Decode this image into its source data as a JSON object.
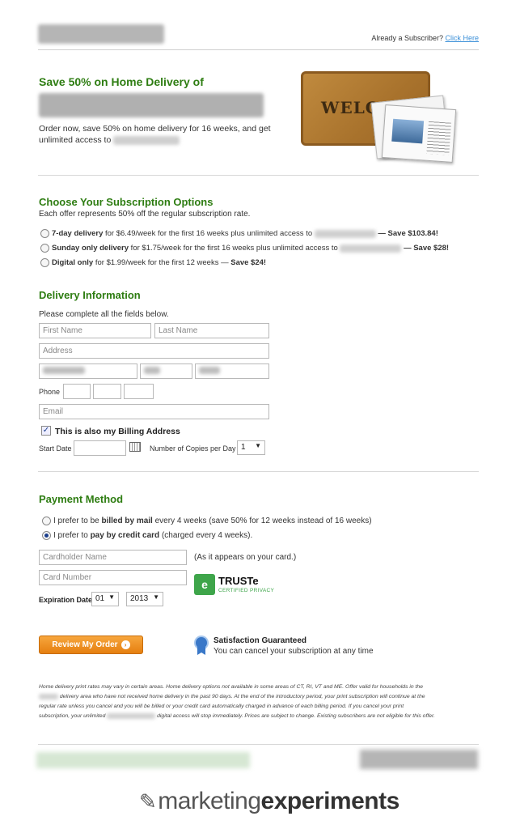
{
  "header": {
    "subscriber_text": "Already a Subscriber?",
    "click_here": "Click Here"
  },
  "hero": {
    "title": "Save 50% on Home Delivery of",
    "text": "Order now, save 50% on home delivery for 16 weeks, and get unlimited access to",
    "doormat_word": "WELCO"
  },
  "subscription": {
    "title": "Choose Your Subscription Options",
    "subtitle": "Each offer represents 50% off the regular subscription rate.",
    "options": [
      {
        "bold": "7-day delivery",
        "text": " for $6.49/week for the first 16 weeks plus unlimited access to",
        "save": "— Save $103.84!"
      },
      {
        "bold": "Sunday only delivery",
        "text": " for $1.75/week for the first 16 weeks plus unlimited access to",
        "save": "— Save $28!"
      },
      {
        "bold": "Digital only",
        "text": " for $1.99/week for the first 12 weeks —",
        "save": "Save $24!"
      }
    ]
  },
  "delivery": {
    "title": "Delivery Information",
    "instructions": "Please complete all the fields below.",
    "first_name_placeholder": "First Name",
    "last_name_placeholder": "Last Name",
    "address_placeholder": "Address",
    "phone_label": "Phone",
    "email_placeholder": "Email",
    "billing_label": "This is also my Billing Address",
    "start_date_label": "Start Date",
    "copies_label": "Number of Copies per Day",
    "copies_value": "1"
  },
  "payment": {
    "title": "Payment Method",
    "mail_option_prefix": "I prefer to be ",
    "mail_option_bold": "billed by mail",
    "mail_option_suffix": " every 4 weeks (save 50% for 12 weeks instead of 16 weeks)",
    "card_option_prefix": "I prefer to ",
    "card_option_bold": "pay by credit card",
    "card_option_suffix": " (charged every 4 weeks).",
    "cardholder_placeholder": "Cardholder Name",
    "cardholder_hint": "(As it appears on your card.)",
    "card_number_placeholder": "Card Number",
    "expiration_label": "Expiration Date",
    "exp_month": "01",
    "exp_year": "2013",
    "truste_name": "TRUSTe",
    "truste_cert": "CERTIFIED PRIVACY"
  },
  "actions": {
    "review_button": "Review My Order",
    "satisfaction_title": "Satisfaction Guaranteed",
    "satisfaction_text": "You can cancel your subscription at any time"
  },
  "fineprint": {
    "line1": "Home delivery print rates may vary in certain areas. Home delivery options not available in some areas of CT, RI, VT and ME. Offer valid for households in the",
    "line2": "delivery area who have not received home delivery in the past 90 days. At the end of the introductory period, your print subscription will continue at the",
    "line3": "regular rate unless you cancel and you will be billed or your credit card automatically charged in advance of each billing period. If you cancel your print",
    "line4a": "subscription, your unlimited",
    "line4b": "digital access will stop immediately. Prices are subject to change. Existing subscribers are not eligible for this offer."
  },
  "branding": {
    "logo_regular": "marketing",
    "logo_bold": "experiments"
  }
}
